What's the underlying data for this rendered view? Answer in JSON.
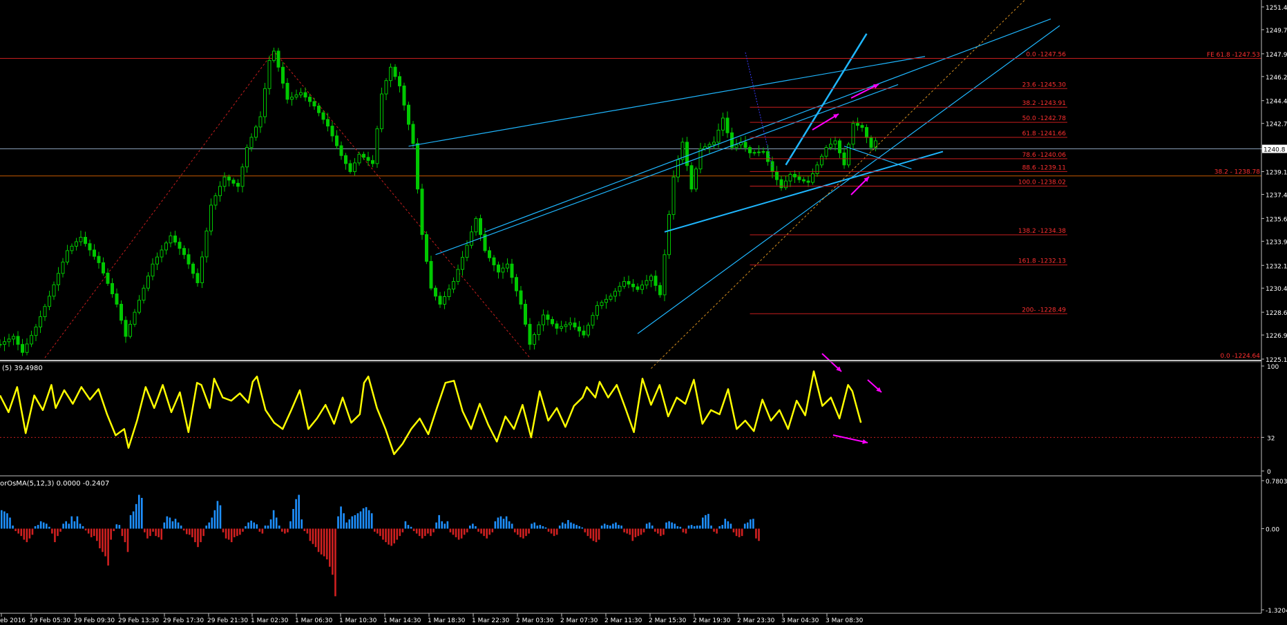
{
  "colors": {
    "background": "#000000",
    "grid_axis": "#c0c0c0",
    "bull_candle": "#00c800",
    "stoch_line": "#ffff00",
    "osma_positive": "#1e90ff",
    "osma_negative": "#d02020",
    "trendline": "#1fb7ff",
    "fib_line": "#c81e1e",
    "fib_text": "#ff3030",
    "arrow": "#ff00ff",
    "zigzag": "#c81e1e",
    "price_line": "#8aa0b8"
  },
  "panels": {
    "stochastic_label": "(5) 39.4980",
    "osma_label": "orOsMA(5,12,3) 0.0000 -0.2407"
  },
  "chart_data": [
    {
      "type": "line",
      "name": "price",
      "ylim": [
        1225.1,
        1251.4
      ],
      "y_ticks": [
        "1251.4",
        "1249.7",
        "1247.9",
        "1246.2",
        "1244.4",
        "1242.7",
        "1240.8",
        "1239.1",
        "1237.4",
        "1235.6",
        "1233.9",
        "1232.1",
        "1230.4",
        "1228.6",
        "1226.9",
        "1225.1"
      ],
      "current_price": "1240.8",
      "fibonacci_levels": [
        {
          "label": "0.0 -1247.56",
          "price": 1247.56
        },
        {
          "label": "23.6 -1245.30",
          "price": 1245.3
        },
        {
          "label": "38.2 -1243.91",
          "price": 1243.91
        },
        {
          "label": "50.0 -1242.78",
          "price": 1242.78
        },
        {
          "label": "61.8 -1241.66",
          "price": 1241.66
        },
        {
          "label": "78.6 -1240.06",
          "price": 1240.06
        },
        {
          "label": "88.6 -1239.11",
          "price": 1239.11
        },
        {
          "label": "100.0 -1238.02",
          "price": 1238.02
        },
        {
          "label": "138.2 -1234.38",
          "price": 1234.38
        },
        {
          "label": "161.8 -1232.13",
          "price": 1232.13
        },
        {
          "label": "200- -1228.49",
          "price": 1228.49
        }
      ],
      "fe_labels": [
        {
          "label": "FE 61.8 -1247.53",
          "price": 1247.53
        },
        {
          "label": "38.2 - 1238.78",
          "price": 1238.78
        },
        {
          "label": "0.0 -1224.64",
          "price": 1225.05
        }
      ],
      "x_ticks": [
        "eb 2016",
        "29 Feb 05:30",
        "29 Feb 09:30",
        "29 Feb 13:30",
        "29 Feb 17:30",
        "29 Feb 21:30",
        "1 Mar 02:30",
        "1 Mar 06:30",
        "1 Mar 10:30",
        "1 Mar 14:30",
        "1 Mar 18:30",
        "1 Mar 22:30",
        "2 Mar 03:30",
        "2 Mar 07:30",
        "2 Mar 11:30",
        "2 Mar 15:30",
        "2 Mar 19:30",
        "2 Mar 23:30",
        "3 Mar 04:30",
        "3 Mar 08:30"
      ],
      "approx_path": [
        [
          0,
          1226.2
        ],
        [
          3,
          1226.8
        ],
        [
          5,
          1225.6
        ],
        [
          8,
          1227.5
        ],
        [
          11,
          1229.8
        ],
        [
          15,
          1233.2
        ],
        [
          18,
          1234.2
        ],
        [
          22,
          1232.3
        ],
        [
          26,
          1229.2
        ],
        [
          28,
          1226.8
        ],
        [
          31,
          1229.5
        ],
        [
          34,
          1232.2
        ],
        [
          38,
          1234.3
        ],
        [
          41,
          1232.9
        ],
        [
          44,
          1230.8
        ],
        [
          47,
          1236.6
        ],
        [
          50,
          1238.7
        ],
        [
          53,
          1238.0
        ],
        [
          55,
          1240.9
        ],
        [
          58,
          1243.2
        ],
        [
          60,
          1247.4
        ],
        [
          61,
          1248.1
        ],
        [
          64,
          1244.5
        ],
        [
          67,
          1245.0
        ],
        [
          70,
          1244.0
        ],
        [
          73,
          1242.5
        ],
        [
          76,
          1240.3
        ],
        [
          78,
          1239.1
        ],
        [
          80,
          1240.4
        ],
        [
          83,
          1239.7
        ],
        [
          85,
          1244.9
        ],
        [
          87,
          1246.9
        ],
        [
          89,
          1245.5
        ],
        [
          92,
          1241.2
        ],
        [
          94,
          1234.4
        ],
        [
          96,
          1230.4
        ],
        [
          98,
          1229.2
        ],
        [
          101,
          1230.9
        ],
        [
          104,
          1233.6
        ],
        [
          106,
          1235.6
        ],
        [
          108,
          1233.2
        ],
        [
          111,
          1231.6
        ],
        [
          113,
          1232.2
        ],
        [
          116,
          1229.2
        ],
        [
          118,
          1226.2
        ],
        [
          121,
          1228.4
        ],
        [
          124,
          1227.4
        ],
        [
          127,
          1227.8
        ],
        [
          130,
          1226.9
        ],
        [
          133,
          1229.1
        ],
        [
          136,
          1229.8
        ],
        [
          139,
          1230.9
        ],
        [
          142,
          1230.3
        ],
        [
          145,
          1231.3
        ],
        [
          147,
          1229.9
        ],
        [
          149,
          1235.9
        ],
        [
          150,
          1238.7
        ],
        [
          152,
          1241.3
        ],
        [
          154,
          1237.8
        ],
        [
          156,
          1240.8
        ],
        [
          159,
          1241.3
        ],
        [
          161,
          1243.1
        ],
        [
          163,
          1240.9
        ],
        [
          165,
          1241.3
        ],
        [
          167,
          1240.5
        ],
        [
          170,
          1240.6
        ],
        [
          172,
          1239.1
        ],
        [
          174,
          1237.9
        ],
        [
          176,
          1238.9
        ],
        [
          178,
          1238.5
        ],
        [
          180,
          1238.3
        ],
        [
          182,
          1239.6
        ],
        [
          184,
          1240.9
        ],
        [
          186,
          1241.4
        ],
        [
          188,
          1239.6
        ],
        [
          190,
          1242.7
        ],
        [
          192,
          1242.4
        ],
        [
          194,
          1240.9
        ],
        [
          195,
          1241.4
        ]
      ]
    },
    {
      "type": "line",
      "name": "stochastic",
      "ylim": [
        0,
        100
      ],
      "y_ticks": [
        "100",
        "32",
        "0"
      ],
      "levels": [
        32
      ],
      "approx_path": [
        [
          0,
          72
        ],
        [
          2,
          56
        ],
        [
          4,
          80
        ],
        [
          6,
          36
        ],
        [
          8,
          72
        ],
        [
          10,
          58
        ],
        [
          12,
          82
        ],
        [
          13,
          60
        ],
        [
          15,
          77
        ],
        [
          17,
          64
        ],
        [
          19,
          80
        ],
        [
          21,
          68
        ],
        [
          23,
          78
        ],
        [
          25,
          54
        ],
        [
          27,
          34
        ],
        [
          29,
          40
        ],
        [
          30,
          22
        ],
        [
          32,
          48
        ],
        [
          34,
          80
        ],
        [
          36,
          60
        ],
        [
          38,
          82
        ],
        [
          40,
          56
        ],
        [
          42,
          75
        ],
        [
          44,
          37
        ],
        [
          46,
          84
        ],
        [
          47,
          82
        ],
        [
          49,
          60
        ],
        [
          50,
          88
        ],
        [
          52,
          70
        ],
        [
          54,
          67
        ],
        [
          56,
          74
        ],
        [
          58,
          65
        ],
        [
          59,
          85
        ],
        [
          60,
          90
        ],
        [
          62,
          58
        ],
        [
          64,
          46
        ],
        [
          66,
          40
        ],
        [
          68,
          58
        ],
        [
          70,
          77
        ],
        [
          72,
          40
        ],
        [
          74,
          50
        ],
        [
          76,
          63
        ],
        [
          78,
          45
        ],
        [
          80,
          70
        ],
        [
          82,
          46
        ],
        [
          84,
          54
        ],
        [
          85,
          84
        ],
        [
          86,
          90
        ],
        [
          88,
          60
        ],
        [
          90,
          40
        ],
        [
          92,
          16
        ],
        [
          94,
          26
        ],
        [
          96,
          40
        ],
        [
          98,
          50
        ],
        [
          100,
          35
        ],
        [
          102,
          60
        ],
        [
          104,
          84
        ],
        [
          106,
          86
        ],
        [
          108,
          57
        ],
        [
          110,
          40
        ],
        [
          112,
          64
        ],
        [
          114,
          44
        ],
        [
          116,
          28
        ],
        [
          118,
          52
        ],
        [
          120,
          40
        ],
        [
          122,
          63
        ],
        [
          124,
          32
        ],
        [
          126,
          76
        ],
        [
          128,
          48
        ],
        [
          130,
          60
        ],
        [
          132,
          42
        ],
        [
          134,
          62
        ],
        [
          136,
          70
        ],
        [
          137,
          80
        ],
        [
          139,
          70
        ],
        [
          140,
          85
        ],
        [
          142,
          70
        ],
        [
          144,
          82
        ],
        [
          146,
          60
        ],
        [
          148,
          37
        ],
        [
          150,
          88
        ],
        [
          152,
          63
        ],
        [
          154,
          82
        ],
        [
          156,
          52
        ],
        [
          158,
          70
        ],
        [
          160,
          64
        ],
        [
          162,
          87
        ],
        [
          164,
          45
        ],
        [
          166,
          58
        ],
        [
          168,
          54
        ],
        [
          170,
          78
        ],
        [
          172,
          40
        ],
        [
          174,
          48
        ],
        [
          176,
          38
        ],
        [
          178,
          68
        ],
        [
          180,
          48
        ],
        [
          182,
          58
        ],
        [
          184,
          40
        ],
        [
          186,
          67
        ],
        [
          188,
          53
        ],
        [
          190,
          95
        ],
        [
          192,
          62
        ],
        [
          194,
          70
        ],
        [
          196,
          50
        ],
        [
          198,
          82
        ],
        [
          199,
          76
        ],
        [
          201,
          46
        ]
      ]
    },
    {
      "type": "bar",
      "name": "OsMA",
      "ylim": [
        -1.3204,
        0.7803
      ],
      "y_ticks": [
        "0.7803",
        "0.00",
        "-1.3204"
      ],
      "approx_values": [
        0.3,
        0.28,
        0.25,
        0.18,
        0.05,
        -0.04,
        -0.08,
        -0.12,
        -0.18,
        -0.22,
        -0.16,
        -0.1,
        0.04,
        0.06,
        0.12,
        0.1,
        0.08,
        0.03,
        -0.08,
        -0.22,
        -0.12,
        -0.05,
        0.08,
        0.12,
        0.08,
        0.2,
        0.12,
        0.2,
        0.08,
        0.04,
        -0.03,
        -0.08,
        -0.14,
        -0.12,
        -0.2,
        -0.32,
        -0.38,
        -0.45,
        -0.6,
        -0.18,
        -0.04,
        0.07,
        0.06,
        -0.12,
        -0.22,
        -0.38,
        0.22,
        0.28,
        0.4,
        0.55,
        0.5,
        -0.06,
        -0.16,
        -0.12,
        -0.05,
        -0.12,
        -0.14,
        -0.18,
        0.1,
        0.2,
        0.18,
        0.12,
        0.16,
        0.1,
        0.05,
        -0.03,
        -0.09,
        -0.1,
        -0.14,
        -0.22,
        -0.3,
        -0.22,
        -0.12,
        0.05,
        0.1,
        0.18,
        0.3,
        0.45,
        0.38,
        -0.06,
        -0.16,
        -0.18,
        -0.22,
        -0.14,
        -0.12,
        -0.1,
        -0.05,
        0.04,
        0.1,
        0.13,
        0.1,
        0.07,
        -0.05,
        -0.08,
        0.05,
        0.05,
        0.15,
        0.3,
        0.18,
        0.05,
        -0.05,
        -0.08,
        -0.06,
        0.12,
        0.32,
        0.48,
        0.55,
        0.15,
        -0.04,
        -0.08,
        -0.2,
        -0.25,
        -0.3,
        -0.38,
        -0.42,
        -0.45,
        -0.5,
        -0.62,
        -0.75,
        -1.1,
        0.2,
        0.36,
        0.25,
        0.1,
        0.15,
        0.2,
        0.22,
        0.25,
        0.28,
        0.33,
        0.35,
        0.3,
        0.25,
        -0.05,
        -0.08,
        -0.12,
        -0.18,
        -0.22,
        -0.26,
        -0.28,
        -0.24,
        -0.18,
        -0.12,
        -0.06,
        0.12,
        0.06,
        0.03,
        -0.04,
        -0.08,
        -0.12,
        -0.16,
        -0.12,
        -0.08,
        -0.12,
        -0.06,
        0.1,
        0.22,
        0.12,
        0.08,
        0.12,
        -0.06,
        -0.1,
        -0.14,
        -0.18,
        -0.16,
        -0.1,
        -0.06,
        0.05,
        0.08,
        0.04,
        -0.05,
        -0.08,
        -0.12,
        -0.16,
        -0.1,
        -0.06,
        0.12,
        0.18,
        0.2,
        0.16,
        0.2,
        0.12,
        0.08,
        -0.06,
        -0.1,
        -0.14,
        -0.16,
        -0.12,
        -0.08,
        0.08,
        0.1,
        0.05,
        0.06,
        0.04,
        0.02,
        -0.05,
        -0.08,
        -0.12,
        -0.1,
        0.05,
        0.1,
        0.08,
        0.14,
        0.1,
        0.08,
        0.06,
        0.04,
        0.02,
        -0.06,
        -0.12,
        -0.16,
        -0.2,
        -0.22,
        -0.18,
        0.05,
        0.08,
        0.06,
        0.05,
        0.08,
        0.1,
        0.06,
        0.05,
        -0.06,
        -0.08,
        -0.1,
        -0.2,
        -0.14,
        -0.12,
        -0.1,
        -0.06,
        0.08,
        0.1,
        0.05,
        -0.05,
        -0.08,
        -0.12,
        -0.1,
        0.1,
        0.12,
        0.1,
        0.08,
        0.04,
        0.03,
        -0.06,
        -0.08,
        0.05,
        0.06,
        0.04,
        0.05,
        0.05,
        0.18,
        0.22,
        0.24,
        0.05,
        -0.05,
        -0.08,
        0.04,
        0.06,
        0.16,
        0.12,
        0.08,
        -0.06,
        -0.12,
        -0.14,
        -0.12,
        0.08,
        0.1,
        0.15,
        0.16,
        -0.16,
        -0.2
      ]
    }
  ]
}
